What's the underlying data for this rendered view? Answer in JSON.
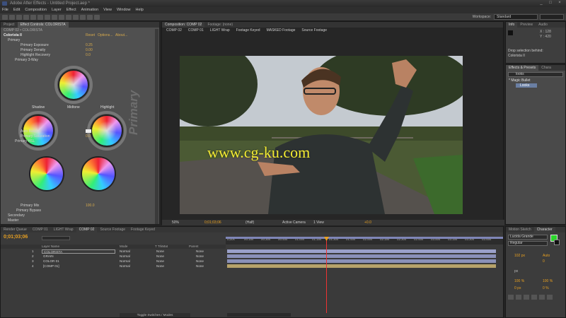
{
  "titlebar": {
    "title": "Adobe After Effects - Untitled Project.aep *"
  },
  "window_buttons": [
    "_",
    "□",
    "×"
  ],
  "menu": [
    "File",
    "Edit",
    "Composition",
    "Layer",
    "Effect",
    "Animation",
    "View",
    "Window",
    "Help"
  ],
  "workspace": {
    "label": "Workspace:",
    "value": "Standard"
  },
  "left_panel": {
    "tabs": [
      "Project",
      "Effect Controls: COLORISTA"
    ],
    "breadcrumb": "COMP 02 • COLORISTA",
    "effect_name": "Colorista II",
    "effect_links": [
      "Reset",
      "Options...",
      "About..."
    ],
    "primary": "Primary",
    "rows": [
      {
        "label": "Primary Exposure",
        "value": "0.25"
      },
      {
        "label": "Primary Density",
        "value": "0.00"
      },
      {
        "label": "Highlight Recovery",
        "value": "0.0"
      }
    ],
    "three_way": "Primary 3-Way",
    "shadow": "Shadow",
    "midtone": "Midtone",
    "highlight": "Highlight",
    "vertical_label": "Primary",
    "auto_balance": "Auto Balance",
    "saturation": {
      "label": "Primary Saturation",
      "value": "0.0"
    },
    "hsl": "Primary HSL",
    "mix": {
      "label": "Primary Mix",
      "value": "100.0"
    },
    "bypass": "Primary Bypass",
    "secondary": "Secondary",
    "master": "Master"
  },
  "comp_panel": {
    "tabs": [
      "Composition: COMP 02",
      "Footage: (none)"
    ],
    "flowchart": [
      "COMP 02",
      "COMP 01",
      "LIGHT Wrap",
      "Footage Keyed",
      "MASKED Footage",
      "Source Footage"
    ],
    "watermark": "www.cg-ku.com",
    "bottom": {
      "zoom": "50%",
      "time": "0;01;03;06",
      "res": "(Half)",
      "camera": "Active Camera",
      "view": "1 View",
      "exposure": "+0.0"
    }
  },
  "info_panel": {
    "tabs": [
      "Info",
      "Preview",
      "Audio"
    ],
    "x": "X : 128",
    "y": "Y : 420",
    "drop_text": "Drop selection behind:",
    "drop_target": "Colorista II"
  },
  "fx_panel": {
    "tabs": [
      "Effects & Presets",
      "Chara"
    ],
    "search": "looks",
    "category": "* Magic Bullet",
    "item": "Looks"
  },
  "timeline": {
    "tabs": [
      "Render Queue",
      "COMP 01",
      "LIGHT Wrap",
      "COMP 02",
      "Source Footage",
      "Footage Keyed"
    ],
    "timecode": "0;01;03;06",
    "col_headers": [
      "Layer Name",
      "Mode",
      "T TrkMat",
      "Parent"
    ],
    "layers": [
      {
        "num": "1",
        "name": "COLORISTA",
        "mode": "Normal",
        "trk": "None",
        "parent": "None"
      },
      {
        "num": "2",
        "name": "GRAIN",
        "mode": "Normal",
        "trk": "None",
        "parent": "None"
      },
      {
        "num": "3",
        "name": "COLOR 01",
        "mode": "Normal",
        "trk": "None",
        "parent": "None"
      },
      {
        "num": "4",
        "name": "[COMP 01]",
        "mode": "Normal",
        "trk": "None",
        "parent": "None"
      }
    ],
    "ruler": [
      "0;00s",
      "00:15s",
      "00:30s",
      "00:45s",
      "01:00s",
      "01:15s",
      "01:30s",
      "01:45s",
      "02:00s",
      "02:15s",
      "02:30s",
      "02:45s",
      "03:00s",
      "03:15s",
      "03:30s",
      "03:45s"
    ],
    "toggle": "Toggle Switches / Modes"
  },
  "char_panel": {
    "tabs": [
      "Motion Sketch",
      "Character"
    ],
    "font": "Lucida Grande",
    "style": "Regular",
    "size": "102 px",
    "leading": "Auto",
    "tracking": "0",
    "px_label": "px",
    "scale_v": "100 %",
    "scale_h": "100 %",
    "baseline": "0 px",
    "tsume": "0 %"
  },
  "colors": {
    "accent_orange": "#e8a020",
    "green_swatch": "#2ad62a"
  }
}
